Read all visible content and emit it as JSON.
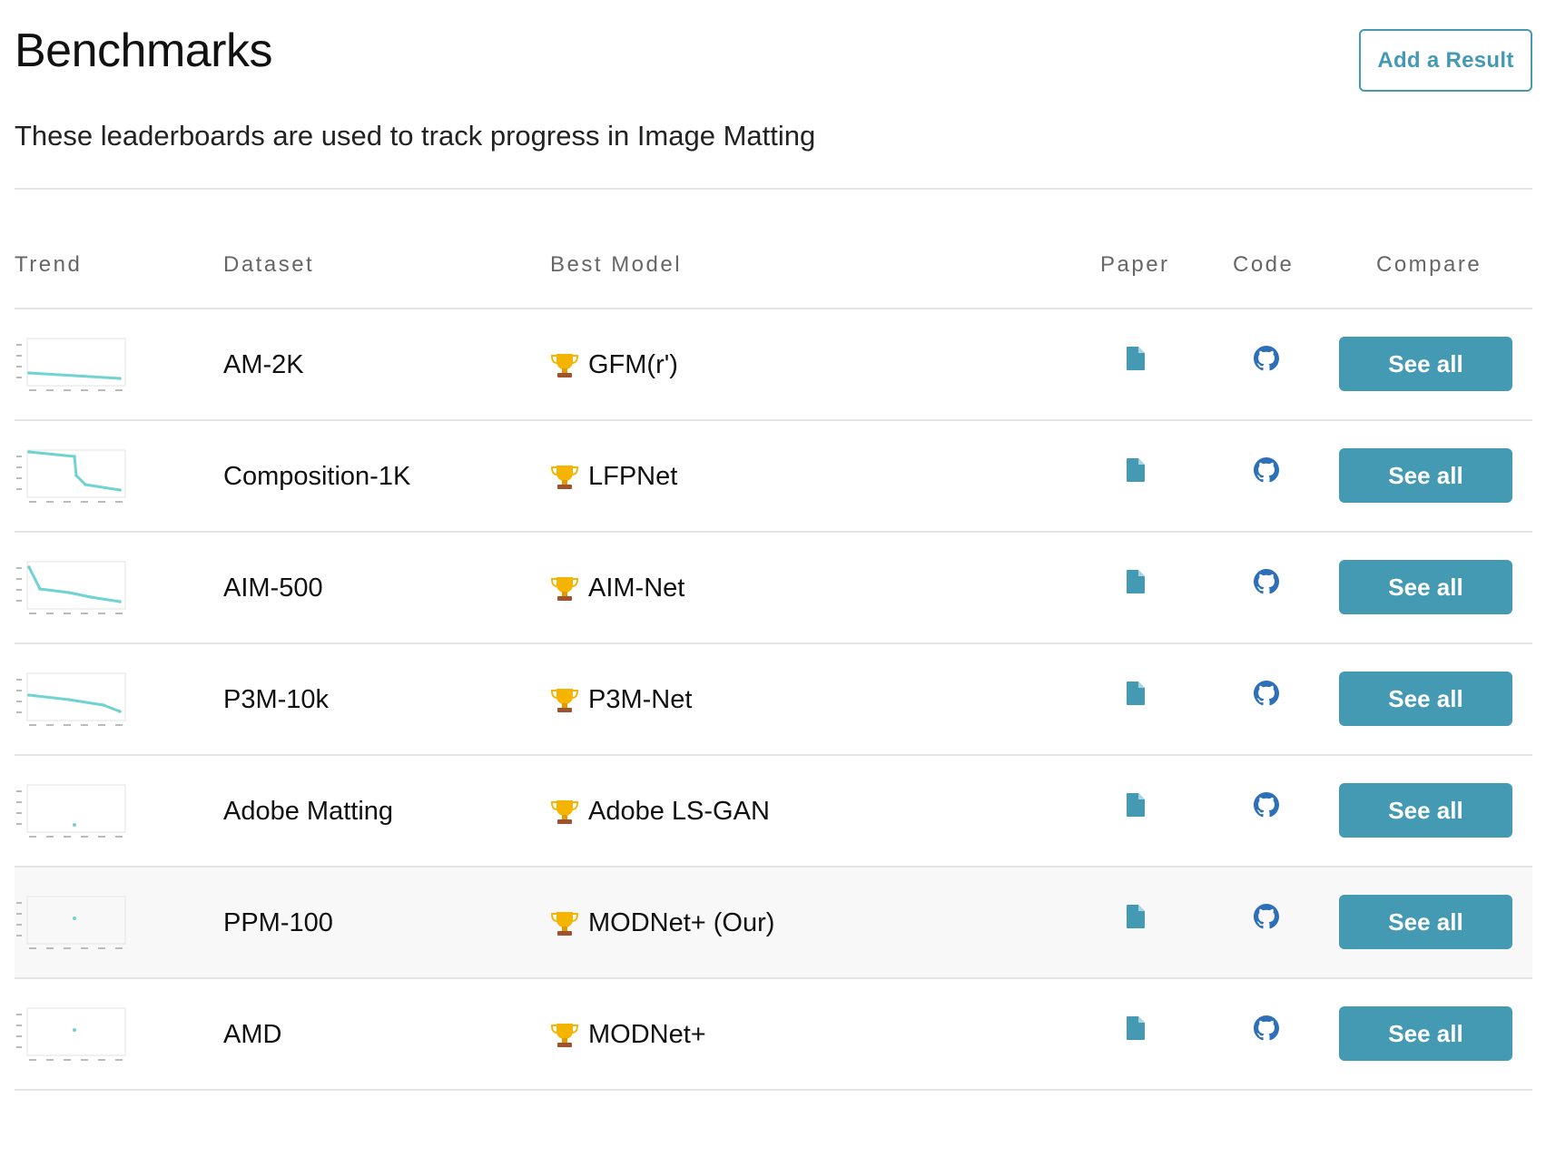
{
  "header": {
    "title": "Benchmarks",
    "add_result_label": "Add a Result",
    "subtitle": "These leaderboards are used to track progress in Image Matting"
  },
  "table": {
    "columns": {
      "trend": "Trend",
      "dataset": "Dataset",
      "best_model": "Best Model",
      "paper": "Paper",
      "code": "Code",
      "compare": "Compare"
    },
    "rows": [
      {
        "dataset": "AM-2K",
        "best_model": "GFM(r')",
        "compare_label": "See all",
        "highlighted": false
      },
      {
        "dataset": "Composition-1K",
        "best_model": "LFPNet",
        "compare_label": "See all",
        "highlighted": false
      },
      {
        "dataset": "AIM-500",
        "best_model": "AIM-Net",
        "compare_label": "See all",
        "highlighted": false
      },
      {
        "dataset": "P3M-10k",
        "best_model": "P3M-Net",
        "compare_label": "See all",
        "highlighted": false
      },
      {
        "dataset": "Adobe Matting",
        "best_model": "Adobe LS-GAN",
        "compare_label": "See all",
        "highlighted": false
      },
      {
        "dataset": "PPM-100",
        "best_model": "MODNet+ (Our)",
        "compare_label": "See all",
        "highlighted": true
      },
      {
        "dataset": "AMD",
        "best_model": "MODNet+",
        "compare_label": "See all",
        "highlighted": false
      }
    ]
  },
  "icons": {
    "trophy": "trophy-icon",
    "paper": "paper-icon",
    "code": "github-icon"
  },
  "colors": {
    "accent": "#4499b3",
    "trend_line": "#6fd3d1",
    "paper_icon": "#4499b3",
    "code_icon": "#2d6fb8",
    "row_highlight": "#f8f8f8"
  }
}
